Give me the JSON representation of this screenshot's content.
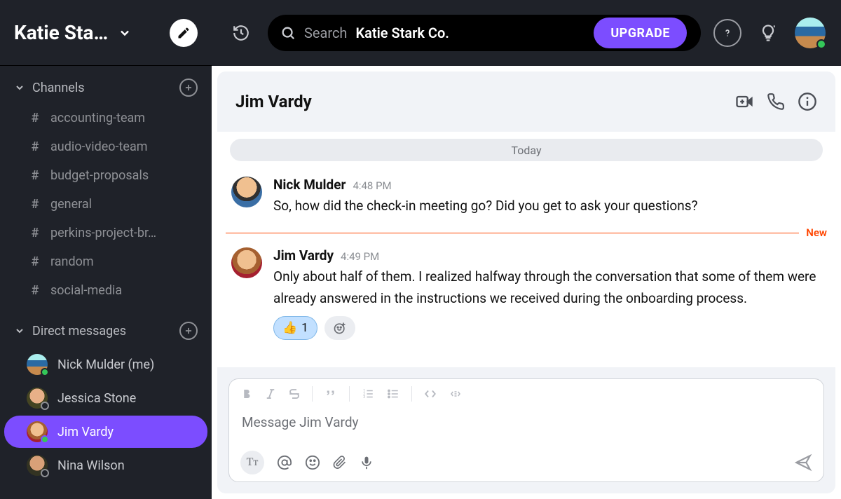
{
  "org": {
    "name": "Katie Sta…"
  },
  "search": {
    "label": "Search",
    "target": "Katie Stark Co."
  },
  "upgrade_label": "UPGRADE",
  "sidebar": {
    "channels_label": "Channels",
    "dm_label": "Direct messages",
    "channels": [
      {
        "name": "accounting-team"
      },
      {
        "name": "audio-video-team"
      },
      {
        "name": "budget-proposals"
      },
      {
        "name": "general"
      },
      {
        "name": "perkins-project-br…"
      },
      {
        "name": "random"
      },
      {
        "name": "social-media"
      }
    ],
    "dms": [
      {
        "name": "Nick Mulder (me)",
        "presence": "online",
        "active": false
      },
      {
        "name": "Jessica Stone",
        "presence": "away",
        "active": false
      },
      {
        "name": "Jim Vardy",
        "presence": "online",
        "active": true
      },
      {
        "name": "Nina Wilson",
        "presence": "away",
        "active": false
      }
    ]
  },
  "conversation": {
    "title": "Jim Vardy",
    "date_label": "Today",
    "new_label": "New",
    "messages": [
      {
        "author": "Nick Mulder",
        "time": "4:48 PM",
        "text": "So, how did the check-in meeting go? Did you get to ask your questions?",
        "avatar": "a1"
      },
      {
        "author": "Jim Vardy",
        "time": "4:49 PM",
        "text": "Only about half of them. I realized halfway through the conversation that some of them were already answered in the instructions we received during the onboarding process.",
        "avatar": "a2",
        "reaction": {
          "emoji": "👍",
          "count": 1
        }
      }
    ]
  },
  "composer": {
    "placeholder": "Message Jim Vardy"
  }
}
